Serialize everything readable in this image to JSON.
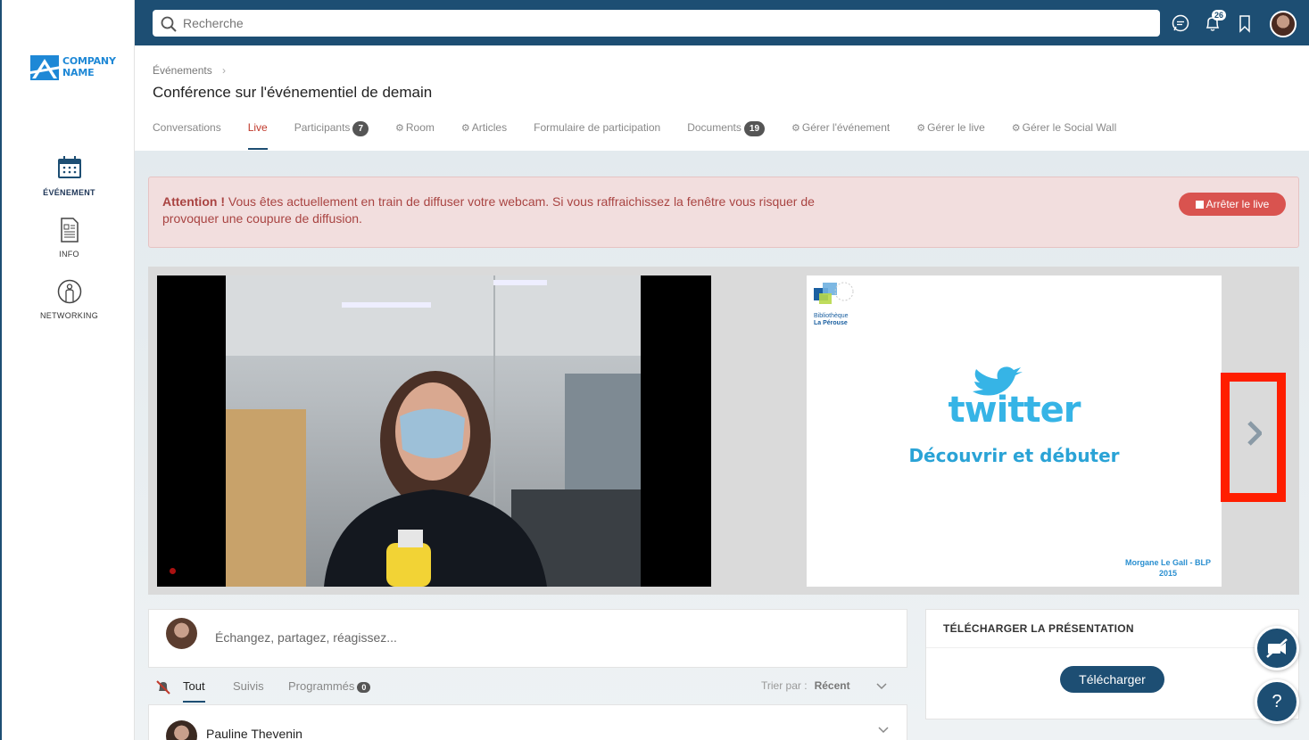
{
  "brand": {
    "logo_line1": "COMPANY",
    "logo_line2": "NAME"
  },
  "sidebar": {
    "items": [
      {
        "label": "ÉVÉNEMENT",
        "icon": "calendar-icon"
      },
      {
        "label": "INFO",
        "icon": "document-icon"
      },
      {
        "label": "NETWORKING",
        "icon": "person-icon"
      }
    ]
  },
  "topbar": {
    "search_placeholder": "Recherche",
    "notification_count": "26"
  },
  "header": {
    "breadcrumb": "Événements",
    "title": "Conférence sur l'événementiel de demain"
  },
  "tabs": [
    {
      "label": "Conversations"
    },
    {
      "label": "Live"
    },
    {
      "label": "Participants",
      "count": "7"
    },
    {
      "label": "Room"
    },
    {
      "label": "Articles"
    },
    {
      "label": "Formulaire de participation"
    },
    {
      "label": "Documents",
      "count": "19"
    },
    {
      "label": "Gérer l'événement"
    },
    {
      "label": "Gérer le live"
    },
    {
      "label": "Gérer le Social Wall"
    }
  ],
  "alert": {
    "strong": "Attention !",
    "message": " Vous êtes actuellement en train de diffuser votre webcam. Si vous raffraichissez la fenêtre vous risquer de provoquer une coupure de diffusion.",
    "stop_label": "Arrêter le live"
  },
  "slide": {
    "library_line1": "Bibliothèque",
    "library_line2": "La Pérouse",
    "brand": "twitter",
    "subtitle": "Découvrir et débuter",
    "author_line1": "Morgane Le Gall - BLP",
    "author_line2": "2015"
  },
  "composer": {
    "placeholder": "Échangez, partagez, réagissez..."
  },
  "feed": {
    "tabs": {
      "all": "Tout",
      "followed": "Suivis",
      "scheduled": "Programmés",
      "scheduled_count": "0"
    },
    "sort_label": "Trier par :",
    "sort_value": "Récent",
    "first_post_author": "Pauline Thevenin"
  },
  "download": {
    "title": "TÉLÉCHARGER LA PRÉSENTATION",
    "button": "Télécharger"
  },
  "help": {
    "label": "?"
  },
  "colors": {
    "primary": "#1d4e73",
    "alert_bg": "#f2dede",
    "alert_text": "#a94442",
    "danger": "#d9534f",
    "highlight": "#ff1e00",
    "active_tab": "#c0392b"
  }
}
